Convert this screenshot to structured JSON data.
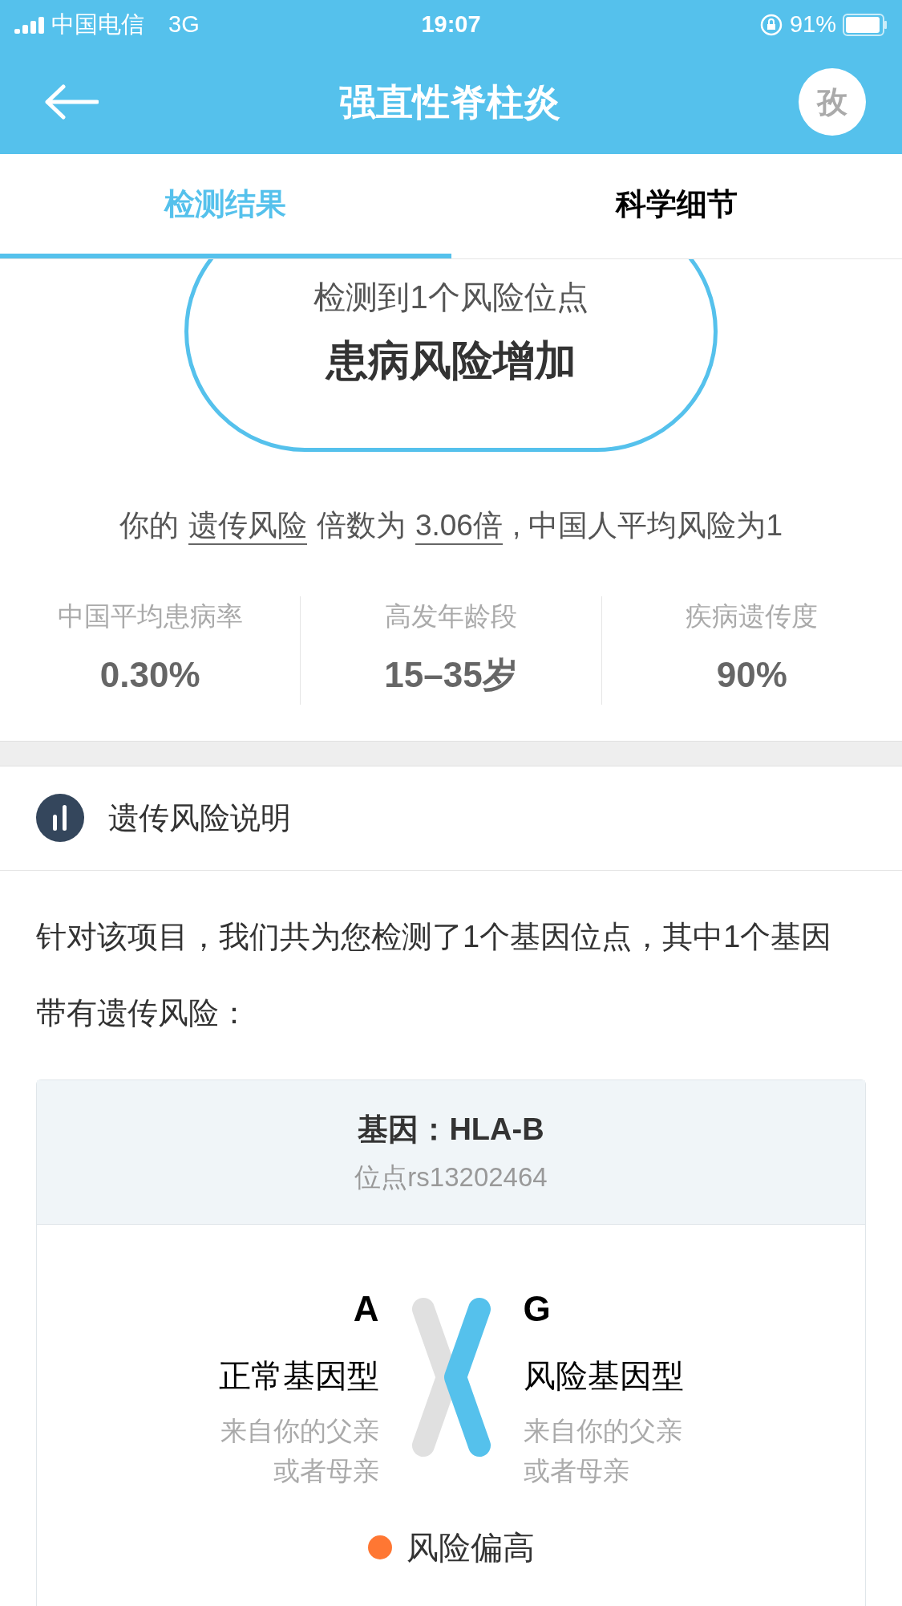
{
  "status_bar": {
    "carrier": "中国电信",
    "network": "3G",
    "time": "19:07",
    "battery": "91%"
  },
  "nav": {
    "title": "强直性脊柱炎",
    "avatar_text": "孜"
  },
  "tabs": [
    {
      "label": "检测结果",
      "selected": true
    },
    {
      "label": "科学细节",
      "selected": false
    }
  ],
  "result": {
    "summary": "检测到1个风险位点",
    "verdict": "患病风险增加"
  },
  "risk_sentence": [
    {
      "text": "你的",
      "underlined": false
    },
    {
      "text": "遗传风险",
      "underlined": true
    },
    {
      "text": "倍数为",
      "underlined": false
    },
    {
      "text": "3.06倍",
      "underlined": true
    },
    {
      "text": ", 中国人平均风险为1",
      "underlined": false
    }
  ],
  "stats": [
    {
      "label": "中国平均患病率",
      "value": "0.30%"
    },
    {
      "label": "高发年龄段",
      "value": "15–35岁"
    },
    {
      "label": "疾病遗传度",
      "value": "90%"
    }
  ],
  "section": {
    "title": "遗传风险说明"
  },
  "intro": "针对该项目，我们共为您检测了1个基因位点，其中1个基因带有遗传风险：",
  "gene_card": {
    "gene": "基因：HLA-B",
    "locus": "位点rs13202464",
    "alleles": [
      {
        "kind": "normal",
        "letter": "A",
        "type": "正常基因型",
        "origin": [
          "来自你的父亲",
          "或者母亲"
        ]
      },
      {
        "kind": "risk",
        "letter": "G",
        "type": "风险基因型",
        "origin": [
          "来自你的父亲",
          "或者母亲"
        ]
      }
    ],
    "risk_level": {
      "label": "风险偏高",
      "color": "#ff7733"
    }
  }
}
